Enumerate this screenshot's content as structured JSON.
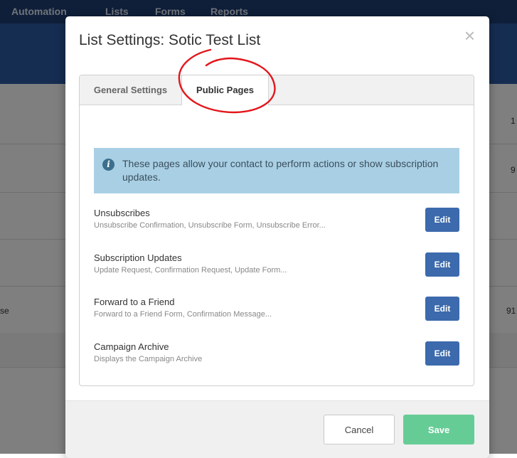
{
  "background": {
    "nav": [
      "Automation",
      "Lists",
      "Forms",
      "Reports"
    ],
    "row_values": [
      "1",
      "9",
      "91"
    ],
    "row_fragment": "se"
  },
  "modal": {
    "title": "List Settings: Sotic Test List",
    "close": "×",
    "tabs": [
      {
        "label": "General Settings",
        "active": false
      },
      {
        "label": "Public Pages",
        "active": true
      }
    ],
    "info": {
      "icon": "i",
      "text": "These pages allow your contact to perform actions or show subscription updates."
    },
    "pages": [
      {
        "name": "Unsubscribes",
        "description": "Unsubscribe Confirmation, Unsubscribe Form, Unsubscribe Error...",
        "button": "Edit"
      },
      {
        "name": "Subscription Updates",
        "description": "Update Request, Confirmation Request, Update Form...",
        "button": "Edit"
      },
      {
        "name": "Forward to a Friend",
        "description": "Forward to a Friend Form, Confirmation Message...",
        "button": "Edit"
      },
      {
        "name": "Campaign Archive",
        "description": "Displays the Campaign Archive",
        "button": "Edit"
      }
    ],
    "footer": {
      "cancel": "Cancel",
      "save": "Save"
    }
  },
  "colors": {
    "primary_button": "#3c6aac",
    "save_button": "#66cc96",
    "info_box": "#a9cfe4",
    "annotation": "#e3161b"
  }
}
